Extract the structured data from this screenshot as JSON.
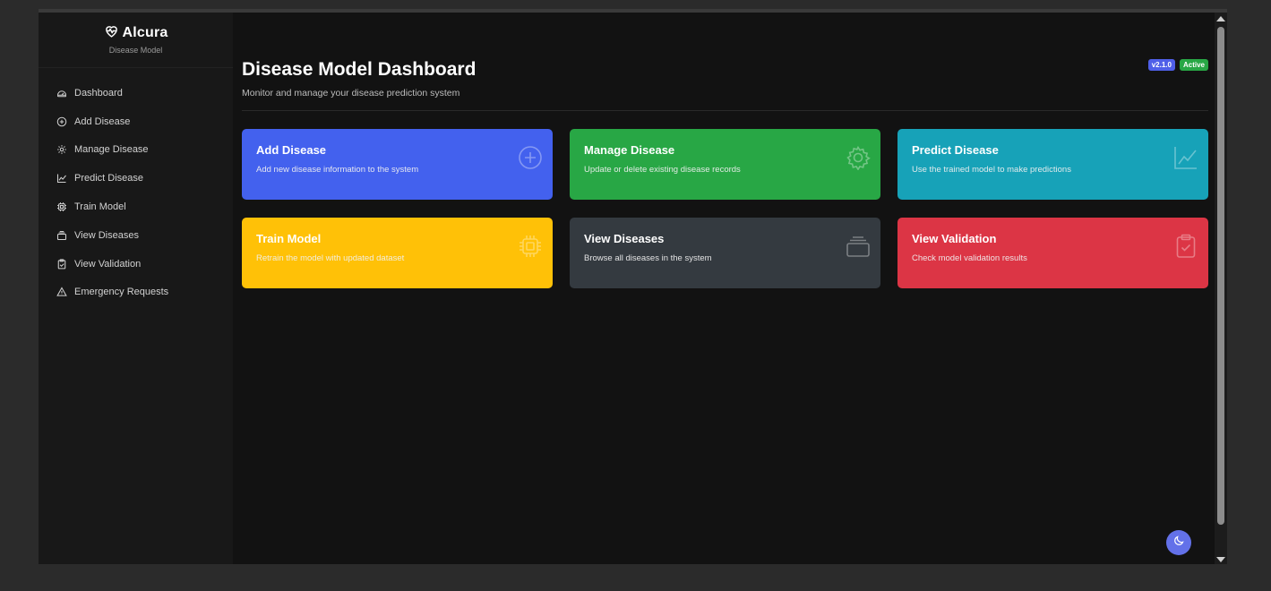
{
  "brand": {
    "name": "Alcura",
    "subtitle": "Disease Model",
    "icon": "heart-pulse-icon"
  },
  "sidebar": {
    "items": [
      {
        "label": "Dashboard",
        "icon": "dashboard-gauge-icon"
      },
      {
        "label": "Add Disease",
        "icon": "plus-circle-icon"
      },
      {
        "label": "Manage Disease",
        "icon": "gear-icon"
      },
      {
        "label": "Predict Disease",
        "icon": "chart-line-icon"
      },
      {
        "label": "Train Model",
        "icon": "cpu-icon"
      },
      {
        "label": "View Diseases",
        "icon": "collection-icon"
      },
      {
        "label": "View Validation",
        "icon": "clipboard-check-icon"
      },
      {
        "label": "Emergency Requests",
        "icon": "warning-triangle-icon"
      }
    ]
  },
  "header": {
    "title": "Disease Model Dashboard",
    "subtitle": "Monitor and manage your disease prediction system",
    "version_badge": "v2.1.0",
    "status_badge": "Active",
    "version_color": "#4f5fe8",
    "status_color": "#28a745"
  },
  "cards": [
    {
      "title": "Add Disease",
      "desc": "Add new disease information to the system",
      "color": "#4361ee",
      "icon": "plus-circle-icon"
    },
    {
      "title": "Manage Disease",
      "desc": "Update or delete existing disease records",
      "color": "#28a745",
      "icon": "gear-icon"
    },
    {
      "title": "Predict Disease",
      "desc": "Use the trained model to make predictions",
      "color": "#17a2b8",
      "icon": "chart-line-icon"
    },
    {
      "title": "Train Model",
      "desc": "Retrain the model with updated dataset",
      "color": "#ffc107",
      "icon": "cpu-icon"
    },
    {
      "title": "View Diseases",
      "desc": "Browse all diseases in the system",
      "color": "#343a40",
      "icon": "collection-icon"
    },
    {
      "title": "View Validation",
      "desc": "Check model validation results",
      "color": "#dc3545",
      "icon": "clipboard-check-icon"
    }
  ],
  "theme_toggle": {
    "icon": "moon-icon",
    "color": "#6371e9"
  }
}
